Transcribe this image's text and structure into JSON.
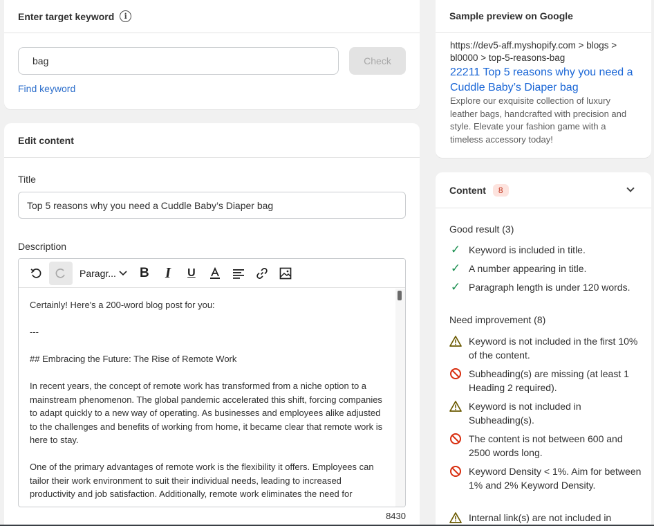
{
  "keyword_card": {
    "title": "Enter target keyword",
    "input_value": "bag",
    "check_label": "Check",
    "find_link": "Find keyword"
  },
  "edit_card": {
    "title": "Edit content",
    "title_label": "Title",
    "title_value": "Top 5 reasons why you need a Cuddle Baby’s Diaper bag",
    "description_label": "Description",
    "paragraph_select": "Paragr...",
    "char_count": "8430",
    "body_lines": [
      "Certainly! Here's a 200-word blog post for you:",
      "---",
      "## Embracing the Future: The Rise of Remote Work",
      "In recent years, the concept of remote work has transformed from a niche option to a mainstream phenomenon. The global pandemic accelerated this shift, forcing companies to adapt quickly to a new way of operating. As businesses and employees alike adjusted to the challenges and benefits of working from home, it became clear that remote work is here to stay.",
      "One of the primary advantages of remote work is the flexibility it offers. Employees can tailor their work environment to suit their individual needs, leading to increased productivity and job satisfaction. Additionally, remote work eliminates the need for"
    ]
  },
  "preview_card": {
    "title": "Sample preview on Google",
    "url": "https://dev5-aff.myshopify.com > blogs > bl0000 > top-5-reasons-bag",
    "link": "22211 Top 5 reasons why you need a Cuddle Baby’s Diaper bag",
    "description": "Explore our exquisite collection of luxury leather bags, handcrafted with precision and style. Elevate your fashion game with a timeless accessory today!"
  },
  "content_card": {
    "title": "Content",
    "badge": "8",
    "good_label": "Good result (3)",
    "good_items": [
      "Keyword is included in title.",
      "A number appearing in title.",
      "Paragraph length is under 120 words."
    ],
    "improve_label": "Need improvement (8)",
    "improve_items": [
      {
        "icon": "warning-icon",
        "text": "Keyword is not included in the first 10% of the content."
      },
      {
        "icon": "ban-icon",
        "text": "Subheading(s) are missing (at least 1 Heading 2 required)."
      },
      {
        "icon": "warning-icon",
        "text": "Keyword is not included in Subheading(s)."
      },
      {
        "icon": "ban-icon",
        "text": "The content is not between 600 and 2500 words long."
      },
      {
        "icon": "ban-icon",
        "text": "Keyword Density < 1%. Aim for between 1% and 2% Keyword Density."
      },
      {
        "icon": "warning-icon",
        "text": "Internal link(s) are not included in"
      }
    ]
  },
  "colors": {
    "link_blue": "#2c6ecb",
    "google_link": "#1a66d6",
    "success": "#1b8f50",
    "critical": "#d82c0d",
    "warning_outline": "#6b5a00"
  }
}
